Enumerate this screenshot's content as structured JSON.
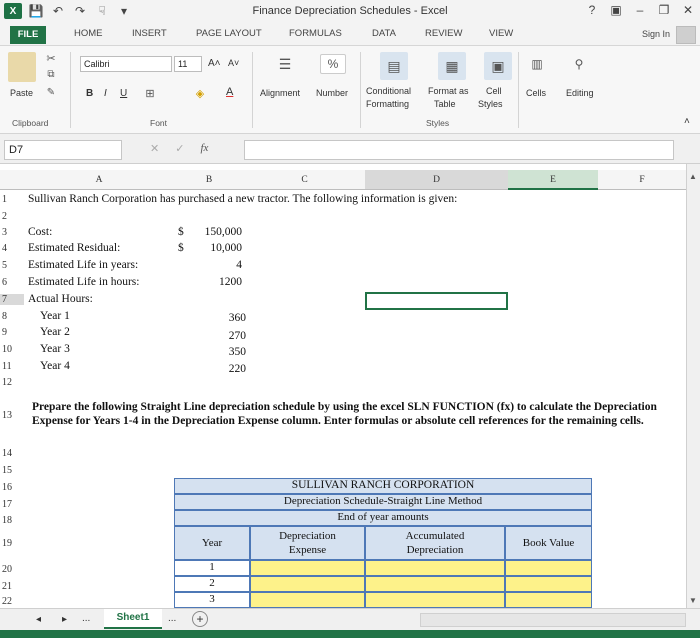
{
  "window": {
    "title": "Finance Depreciation Schedules - Excel",
    "controls": [
      "?",
      "▣",
      "–",
      "❐",
      "✕"
    ]
  },
  "qat": {
    "logo": "X",
    "save": "💾",
    "undo": "↶",
    "redo": "↷",
    "touch": "☟",
    "more": "▾"
  },
  "ribbon_tabs": [
    "FILE",
    "HOME",
    "INSERT",
    "PAGE LAYOUT",
    "FORMULAS",
    "DATA",
    "REVIEW",
    "VIEW"
  ],
  "sign_in": "Sign In",
  "ribbon": {
    "paste": "Paste",
    "font_name": "Calibri",
    "font_size": "11",
    "grow_font": "A˄",
    "shrink_font": "A˅",
    "bold": "B",
    "italic": "I",
    "underline": "U",
    "font_color": "A",
    "alignment": "Alignment",
    "number": "Number",
    "percent": "%",
    "conditional": "Conditional",
    "formatting": "Formatting",
    "format_as": "Format as",
    "table": "Table",
    "cell": "Cell",
    "styles": "Styles",
    "cells": "Cells",
    "editing": "Editing",
    "group_clipboard": "Clipboard",
    "group_font": "Font",
    "group_styles": "Styles"
  },
  "formula_bar": {
    "name_box": "D7",
    "fx": "fx",
    "cancel": "✕",
    "enter": "✓",
    "content": ""
  },
  "columns": [
    "A",
    "B",
    "C",
    "D",
    "E",
    "F"
  ],
  "rows": [
    "1",
    "2",
    "3",
    "4",
    "5",
    "6",
    "7",
    "8",
    "9",
    "10",
    "11",
    "12",
    "13",
    "14",
    "15",
    "16",
    "17",
    "18",
    "19",
    "20",
    "21",
    "22"
  ],
  "sheet": {
    "r1": "Sullivan Ranch Corporation has purchased a new tractor.  The following information is given:",
    "cost_label": "Cost:",
    "cost_cur": "$",
    "cost_val": "150,000",
    "residual_label": "Estimated Residual:",
    "residual_cur": "$",
    "residual_val": "10,000",
    "life_years_label": "Estimated Life in years:",
    "life_years_val": "4",
    "life_hours_label": "Estimated Life in hours:",
    "life_hours_val": "1200",
    "actual_label": "Actual Hours:",
    "years": [
      {
        "label": "Year 1",
        "hours": "360"
      },
      {
        "label": "Year 2",
        "hours": "270"
      },
      {
        "label": "Year 3",
        "hours": "350"
      },
      {
        "label": "Year 4",
        "hours": "220"
      }
    ],
    "instructions": "Prepare the following Straight Line depreciation schedule by using the excel SLN FUNCTION (fx) to calculate the Depreciation Expense for Years 1-4 in the Depreciation Expense column.  Enter formulas or absolute cell references for the remaining cells."
  },
  "table": {
    "title1": "SULLIVAN RANCH CORPORATION",
    "title2": "Depreciation Schedule-Straight Line Method",
    "title3": "End of year amounts",
    "col_year": "Year",
    "col_dep1": "Depreciation",
    "col_dep2": "Expense",
    "col_acc1": "Accumulated",
    "col_acc2": "Depreciation",
    "col_book": "Book Value",
    "years": [
      "1",
      "2",
      "3"
    ]
  },
  "sheet_tabs": {
    "prev": "◂",
    "next": "▸",
    "dots": "...",
    "sheet1": "Sheet1",
    "dots2": "...",
    "add": "+"
  },
  "colors": {
    "excel_green": "#217346",
    "table_blue": "#d5e1f0",
    "table_border": "#4e78b6",
    "input_yellow": "#fdf28a"
  }
}
